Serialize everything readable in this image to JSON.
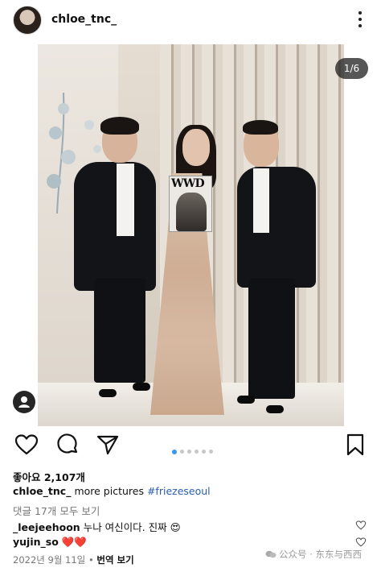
{
  "header": {
    "username": "chloe_tnc_",
    "more_icon": "more-vertical-icon"
  },
  "photo": {
    "counter": "1/6",
    "magazine_title": "WWD",
    "tag_icon": "person-tag-icon"
  },
  "actions": {
    "icons": [
      "heart-icon",
      "comment-icon",
      "share-icon",
      "bookmark-icon"
    ]
  },
  "carousel": {
    "total": 6,
    "active": 1
  },
  "likes": {
    "label": "좋아요 2,107개"
  },
  "caption": {
    "username": "chloe_tnc_",
    "text": "more pictures",
    "hashtag": "#friezeseoul"
  },
  "view_comments": "댓글 17개 모두 보기",
  "comments": [
    {
      "username": "_leejeehoon",
      "text": "누나 여신이다. 진짜 😍"
    },
    {
      "username": "yujin_so",
      "text": "❤️❤️"
    }
  ],
  "footer": {
    "date": "2022년 9월 11일",
    "separator": "•",
    "translate": "번역 보기"
  },
  "watermark": "公众号 · 东东与西西",
  "colors": {
    "accent": "#3897f0",
    "hashtag": "#2a5db0",
    "muted": "#777777"
  }
}
